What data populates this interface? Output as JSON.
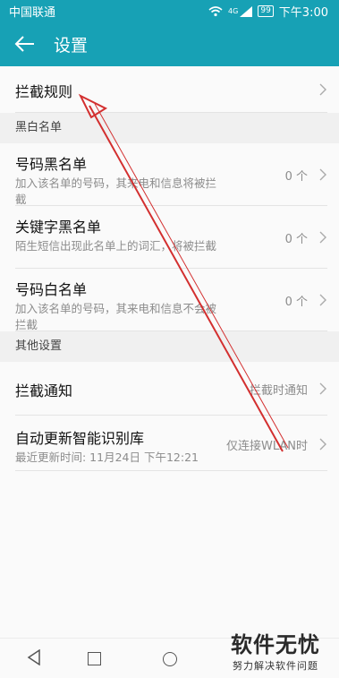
{
  "status_bar": {
    "carrier": "中国联通",
    "signal": "4G",
    "battery": "99",
    "time": "下午3:00",
    "icons": [
      "wifi-icon",
      "signal-icon",
      "battery-icon"
    ]
  },
  "app_bar": {
    "title": "设置",
    "back_icon": "arrow-back-icon"
  },
  "rows": {
    "intercept_rules": {
      "label": "拦截规则"
    }
  },
  "sections": {
    "blacklist": {
      "title": "黑白名单",
      "items": [
        {
          "label": "号码黑名单",
          "desc": "加入该名单的号码，其来电和信息将被拦截",
          "value": "0 个"
        },
        {
          "label": "关键字黑名单",
          "desc": "陌生短信出现此名单上的词汇，将被拦截",
          "value": "0 个"
        },
        {
          "label": "号码白名单",
          "desc": "加入该名单的号码，其来电和信息不会被拦截",
          "value": "0 个"
        }
      ]
    },
    "other": {
      "title": "其他设置",
      "items": [
        {
          "label": "拦截通知",
          "value": "拦截时通知"
        },
        {
          "label": "自动更新智能识别库",
          "desc": "最近更新时间: 11月24日 下午12:21",
          "value": "仅连接WLAN时"
        }
      ]
    }
  },
  "watermark": {
    "main": "软件无忧",
    "sub": "努力解决软件问题"
  },
  "colors": {
    "accent": "#17a1b5",
    "annotation_arrow": "#d32f2f"
  }
}
